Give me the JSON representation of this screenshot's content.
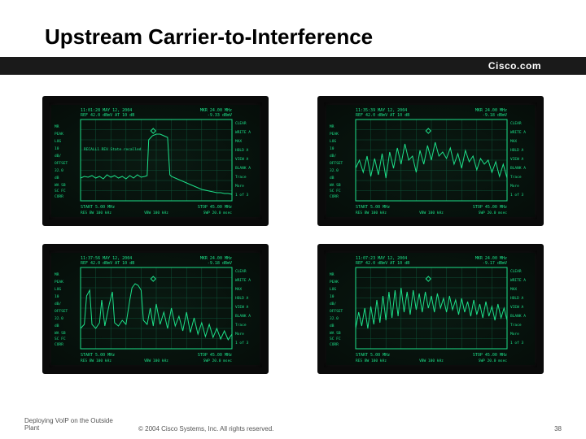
{
  "slide": {
    "title": "Upstream Carrier-to-Interference",
    "logo": "Cisco.com"
  },
  "footer": {
    "left": "Deploying VoIP on the Outside Plant",
    "copyright": "© 2004 Cisco Systems, Inc. All rights reserved.",
    "page": "38"
  },
  "analyzers": {
    "common": {
      "timestamp_prefix": "11:",
      "date_suffix": " MAY 12, 2004",
      "ref": "REF 42.0 dBmV",
      "att": "AT 10 dB",
      "mkr_freq": "MKR 24.00 MHz",
      "start": "START 5.00 MHz",
      "stop": "STOP 45.00 MHz",
      "res": "RES BW 100 kHz",
      "vbw": "VBW 100 kHz",
      "swp": "SWP 20.0 msec",
      "right_labels": [
        "CLEAR",
        "WRITE A",
        "MAX",
        "HOLD A",
        "VIEW A",
        "BLANK A",
        "Trace",
        "More",
        "1 of 3"
      ],
      "left_labels": [
        "MR",
        "PEAK",
        "LOG",
        "10",
        "dB/",
        "OFFSET",
        "32.0",
        "dB"
      ],
      "left_bottom": [
        "WA SB",
        "SC FC",
        "CORR"
      ]
    },
    "screens": [
      {
        "time": "11:01:28",
        "mkr_val": "-9.33 dBmV",
        "recall": "RECALL1 REV State recalled",
        "trace": [
          [
            0,
            72
          ],
          [
            5,
            70
          ],
          [
            10,
            71
          ],
          [
            15,
            69
          ],
          [
            20,
            72
          ],
          [
            25,
            70
          ],
          [
            30,
            73
          ],
          [
            35,
            68
          ],
          [
            40,
            71
          ],
          [
            45,
            69
          ],
          [
            50,
            72
          ],
          [
            55,
            70
          ],
          [
            60,
            73
          ],
          [
            65,
            69
          ],
          [
            70,
            72
          ],
          [
            75,
            68
          ],
          [
            80,
            71
          ],
          [
            85,
            70
          ],
          [
            88,
            69
          ],
          [
            90,
            25
          ],
          [
            95,
            20
          ],
          [
            100,
            18
          ],
          [
            105,
            18
          ],
          [
            110,
            20
          ],
          [
            115,
            22
          ],
          [
            118,
            68
          ],
          [
            120,
            70
          ],
          [
            125,
            72
          ],
          [
            130,
            74
          ],
          [
            135,
            76
          ],
          [
            140,
            78
          ],
          [
            145,
            80
          ],
          [
            150,
            82
          ],
          [
            155,
            84
          ],
          [
            160,
            86
          ],
          [
            165,
            87
          ],
          [
            170,
            88
          ],
          [
            175,
            89
          ],
          [
            180,
            90
          ],
          [
            185,
            90
          ],
          [
            190,
            91
          ],
          [
            195,
            91
          ],
          [
            200,
            92
          ]
        ]
      },
      {
        "time": "11:35:39",
        "mkr_val": "-9.18 dBmV",
        "trace": [
          [
            0,
            60
          ],
          [
            5,
            50
          ],
          [
            10,
            65
          ],
          [
            15,
            45
          ],
          [
            20,
            70
          ],
          [
            25,
            48
          ],
          [
            30,
            68
          ],
          [
            35,
            42
          ],
          [
            40,
            72
          ],
          [
            45,
            40
          ],
          [
            50,
            60
          ],
          [
            55,
            35
          ],
          [
            60,
            55
          ],
          [
            65,
            30
          ],
          [
            70,
            50
          ],
          [
            75,
            45
          ],
          [
            80,
            65
          ],
          [
            85,
            38
          ],
          [
            90,
            55
          ],
          [
            95,
            32
          ],
          [
            100,
            50
          ],
          [
            105,
            28
          ],
          [
            110,
            45
          ],
          [
            115,
            40
          ],
          [
            120,
            48
          ],
          [
            125,
            35
          ],
          [
            130,
            55
          ],
          [
            135,
            42
          ],
          [
            140,
            60
          ],
          [
            145,
            38
          ],
          [
            150,
            52
          ],
          [
            155,
            45
          ],
          [
            160,
            62
          ],
          [
            165,
            48
          ],
          [
            170,
            55
          ],
          [
            175,
            50
          ],
          [
            180,
            65
          ],
          [
            185,
            52
          ],
          [
            190,
            70
          ],
          [
            195,
            55
          ],
          [
            200,
            72
          ]
        ]
      },
      {
        "time": "11:37:56",
        "mkr_val": "-9.18 dBmV",
        "trace": [
          [
            0,
            75
          ],
          [
            5,
            70
          ],
          [
            8,
            35
          ],
          [
            12,
            28
          ],
          [
            15,
            70
          ],
          [
            20,
            75
          ],
          [
            25,
            68
          ],
          [
            28,
            40
          ],
          [
            32,
            72
          ],
          [
            38,
            45
          ],
          [
            42,
            30
          ],
          [
            45,
            68
          ],
          [
            50,
            72
          ],
          [
            55,
            65
          ],
          [
            60,
            70
          ],
          [
            65,
            40
          ],
          [
            68,
            25
          ],
          [
            72,
            20
          ],
          [
            76,
            22
          ],
          [
            80,
            28
          ],
          [
            83,
            65
          ],
          [
            88,
            70
          ],
          [
            92,
            50
          ],
          [
            96,
            72
          ],
          [
            100,
            45
          ],
          [
            105,
            70
          ],
          [
            110,
            55
          ],
          [
            115,
            75
          ],
          [
            120,
            50
          ],
          [
            125,
            72
          ],
          [
            130,
            60
          ],
          [
            135,
            78
          ],
          [
            140,
            55
          ],
          [
            145,
            80
          ],
          [
            150,
            62
          ],
          [
            155,
            82
          ],
          [
            160,
            68
          ],
          [
            165,
            85
          ],
          [
            170,
            70
          ],
          [
            175,
            86
          ],
          [
            180,
            75
          ],
          [
            185,
            88
          ],
          [
            190,
            78
          ],
          [
            195,
            89
          ],
          [
            200,
            82
          ]
        ]
      },
      {
        "time": "11:07:23",
        "mkr_val": "-9.17 dBmV",
        "trace": [
          [
            0,
            75
          ],
          [
            4,
            55
          ],
          [
            8,
            72
          ],
          [
            12,
            50
          ],
          [
            16,
            75
          ],
          [
            20,
            48
          ],
          [
            24,
            70
          ],
          [
            28,
            40
          ],
          [
            32,
            68
          ],
          [
            36,
            35
          ],
          [
            40,
            65
          ],
          [
            44,
            30
          ],
          [
            48,
            62
          ],
          [
            52,
            28
          ],
          [
            56,
            60
          ],
          [
            60,
            25
          ],
          [
            64,
            55
          ],
          [
            68,
            30
          ],
          [
            72,
            58
          ],
          [
            76,
            28
          ],
          [
            80,
            52
          ],
          [
            84,
            32
          ],
          [
            88,
            55
          ],
          [
            92,
            30
          ],
          [
            96,
            50
          ],
          [
            100,
            35
          ],
          [
            104,
            55
          ],
          [
            108,
            32
          ],
          [
            112,
            50
          ],
          [
            116,
            38
          ],
          [
            120,
            55
          ],
          [
            124,
            35
          ],
          [
            128,
            52
          ],
          [
            132,
            40
          ],
          [
            136,
            58
          ],
          [
            140,
            38
          ],
          [
            144,
            55
          ],
          [
            148,
            42
          ],
          [
            152,
            60
          ],
          [
            156,
            40
          ],
          [
            160,
            58
          ],
          [
            164,
            45
          ],
          [
            168,
            62
          ],
          [
            172,
            42
          ],
          [
            176,
            60
          ],
          [
            180,
            48
          ],
          [
            184,
            65
          ],
          [
            188,
            45
          ],
          [
            192,
            62
          ],
          [
            196,
            50
          ],
          [
            200,
            65
          ]
        ]
      }
    ]
  }
}
